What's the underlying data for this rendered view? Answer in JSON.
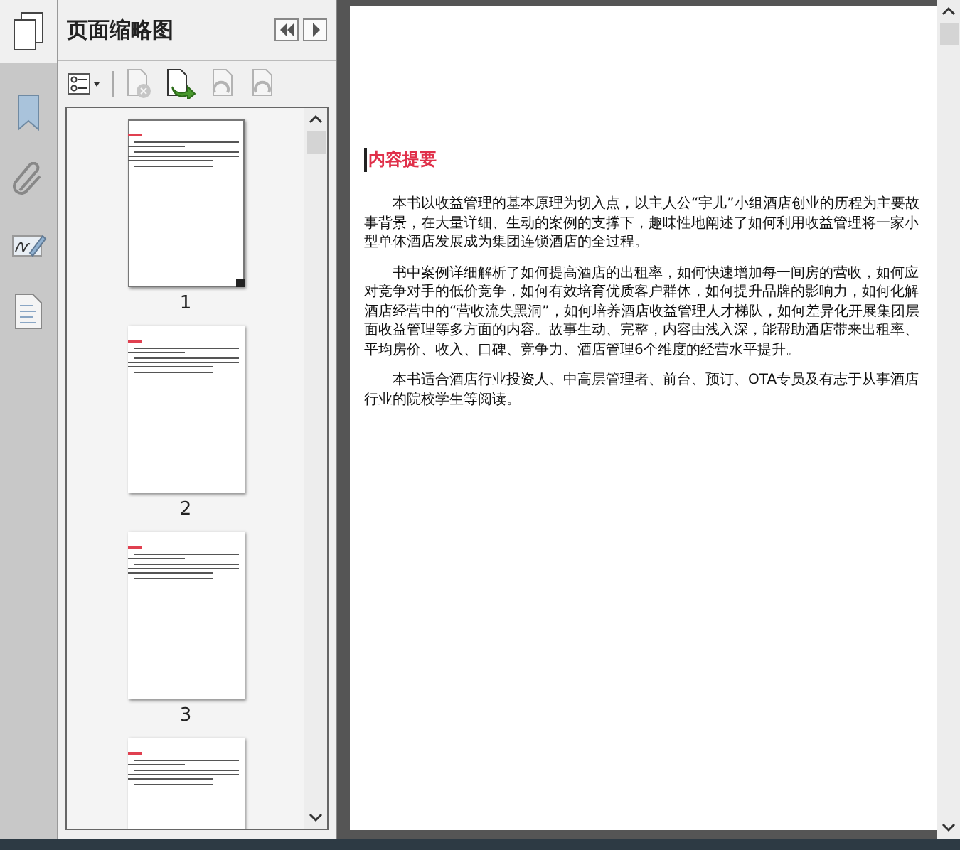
{
  "panel": {
    "title": "页面缩略图"
  },
  "toolbar": [
    {
      "kind": "options",
      "disabled": false
    },
    {
      "kind": "delete",
      "disabled": true
    },
    {
      "kind": "insert",
      "disabled": false
    },
    {
      "kind": "rotate-left",
      "disabled": true
    },
    {
      "kind": "rotate-right",
      "disabled": true
    }
  ],
  "thumbnails": [
    {
      "label": "1",
      "selected": true
    },
    {
      "label": "2",
      "selected": false
    },
    {
      "label": "3",
      "selected": false
    },
    {
      "selected": false
    }
  ],
  "document": {
    "heading": "内容提要",
    "paragraphs": [
      "本书以收益管理的基本原理为切入点，以主人公“宇儿”小组酒店创业的历程为主要故事背景，在大量详细、生动的案例的支撑下，趣味性地阐述了如何利用收益管理将一家小型单体酒店发展成为集团连锁酒店的全过程。",
      "书中案例详细解析了如何提高酒店的出租率，如何快速增加每一间房的营收，如何应对竞争对手的低价竞争，如何有效培育优质客户群体，如何提升品牌的影响力，如何化解酒店经营中的“营收流失黑洞”，如何培养酒店收益管理人才梯队，如何差异化开展集团层面收益管理等多方面的内容。故事生动、完整，内容由浅入深，能帮助酒店带来出租率、平均房价、收入、口碑、竞争力、酒店管理6个维度的经营水平提升。",
      "本书适合酒店行业投资人、中高层管理者、前台、预订、OTA专员及有志于从事酒店行业的院校学生等阅读。"
    ]
  }
}
